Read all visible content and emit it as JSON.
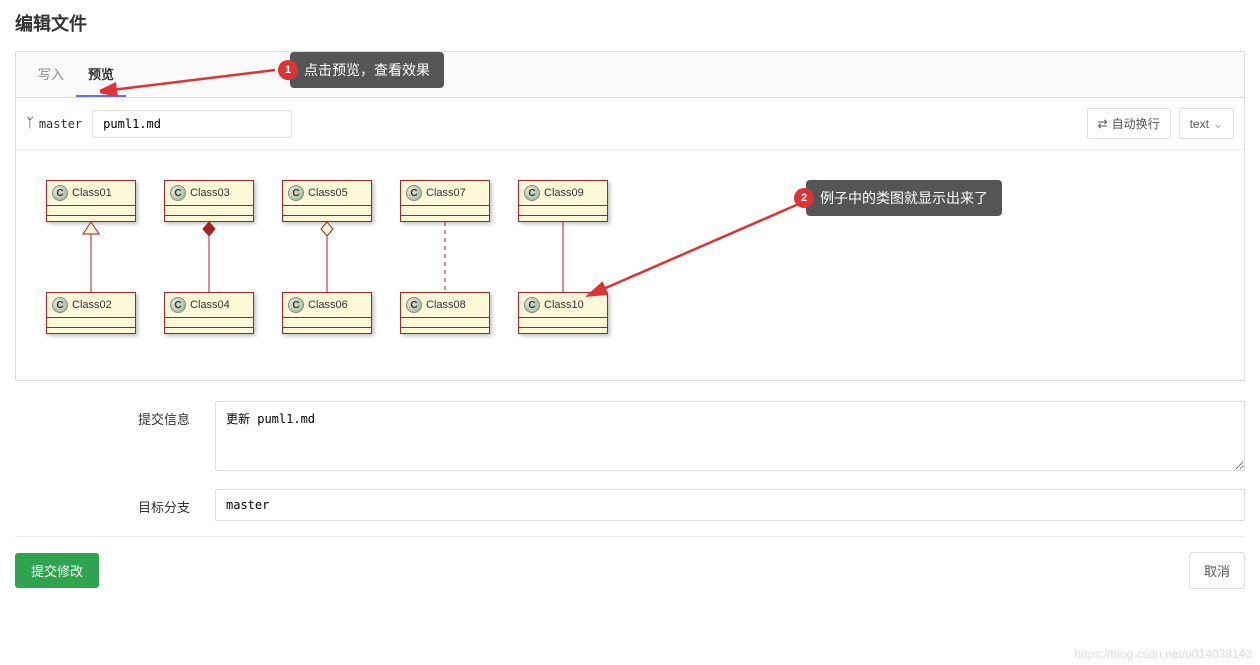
{
  "page_title": "编辑文件",
  "tabs": {
    "write": "写入",
    "preview": "预览"
  },
  "toolbar": {
    "branch": "master",
    "filename": "puml1.md",
    "wrap_btn": "自动换行",
    "mode_btn": "text"
  },
  "diagram": {
    "pairs": [
      {
        "top": "Class01",
        "bottom": "Class02",
        "rel": "inherit"
      },
      {
        "top": "Class03",
        "bottom": "Class04",
        "rel": "composition"
      },
      {
        "top": "Class05",
        "bottom": "Class06",
        "rel": "aggregation"
      },
      {
        "top": "Class07",
        "bottom": "Class08",
        "rel": "dependency"
      },
      {
        "top": "Class09",
        "bottom": "Class10",
        "rel": "association"
      }
    ]
  },
  "callouts": {
    "c1": {
      "num": "1",
      "text": "点击预览，查看效果"
    },
    "c2": {
      "num": "2",
      "text": "例子中的类图就显示出来了"
    }
  },
  "form": {
    "commit_label": "提交信息",
    "commit_value": "更新 puml1.md",
    "branch_label": "目标分支",
    "branch_value": "master"
  },
  "footer": {
    "submit": "提交修改",
    "cancel": "取消"
  },
  "watermark": "https://blog.csdn.net/u014038143"
}
